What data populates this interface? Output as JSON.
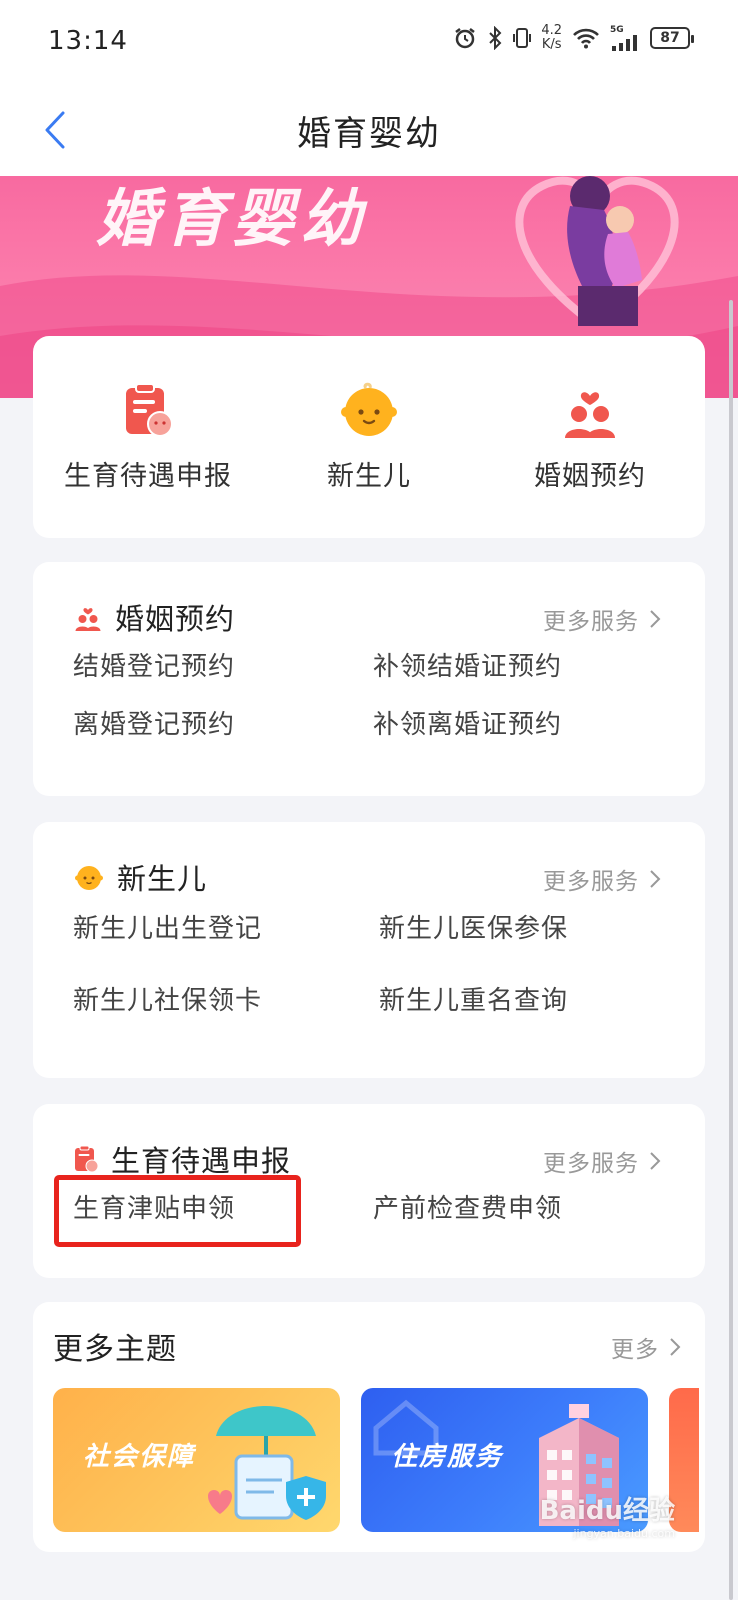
{
  "status_bar": {
    "time": "13:14",
    "net_speed_value": "4.2",
    "net_speed_unit": "K/s",
    "network_type": "5G",
    "battery": "87"
  },
  "nav": {
    "title": "婚育婴幼"
  },
  "banner": {
    "title": "婚育婴幼"
  },
  "quick_actions": [
    {
      "label": "生育待遇申报",
      "icon": "clipboard-baby-icon"
    },
    {
      "label": "新生儿",
      "icon": "baby-face-icon"
    },
    {
      "label": "婚姻预约",
      "icon": "couple-heart-icon"
    }
  ],
  "sections": {
    "marriage": {
      "title": "婚姻预约",
      "more": "更多服务",
      "links": [
        "结婚登记预约",
        "补领结婚证预约",
        "离婚登记预约",
        "补领离婚证预约"
      ]
    },
    "newborn": {
      "title": "新生儿",
      "more": "更多服务",
      "links": [
        "新生儿出生登记",
        "新生儿医保参保",
        "新生儿社保领卡",
        "新生儿重名查询"
      ]
    },
    "fertility": {
      "title": "生育待遇申报",
      "more": "更多服务",
      "links": [
        "生育津贴申领",
        "产前检查费申领"
      ]
    }
  },
  "topics": {
    "title": "更多主题",
    "more": "更多",
    "tiles": [
      "社会保障",
      "住房服务"
    ]
  },
  "watermark": {
    "text": "Baidu经验",
    "sub": "jingyan.baidu.com"
  },
  "colors": {
    "accent": "#3a7bf2",
    "banner_pink": "#f86aa0",
    "highlight_red": "#e8231d",
    "icon_red": "#f0574e",
    "icon_yellow": "#ffb21e"
  }
}
